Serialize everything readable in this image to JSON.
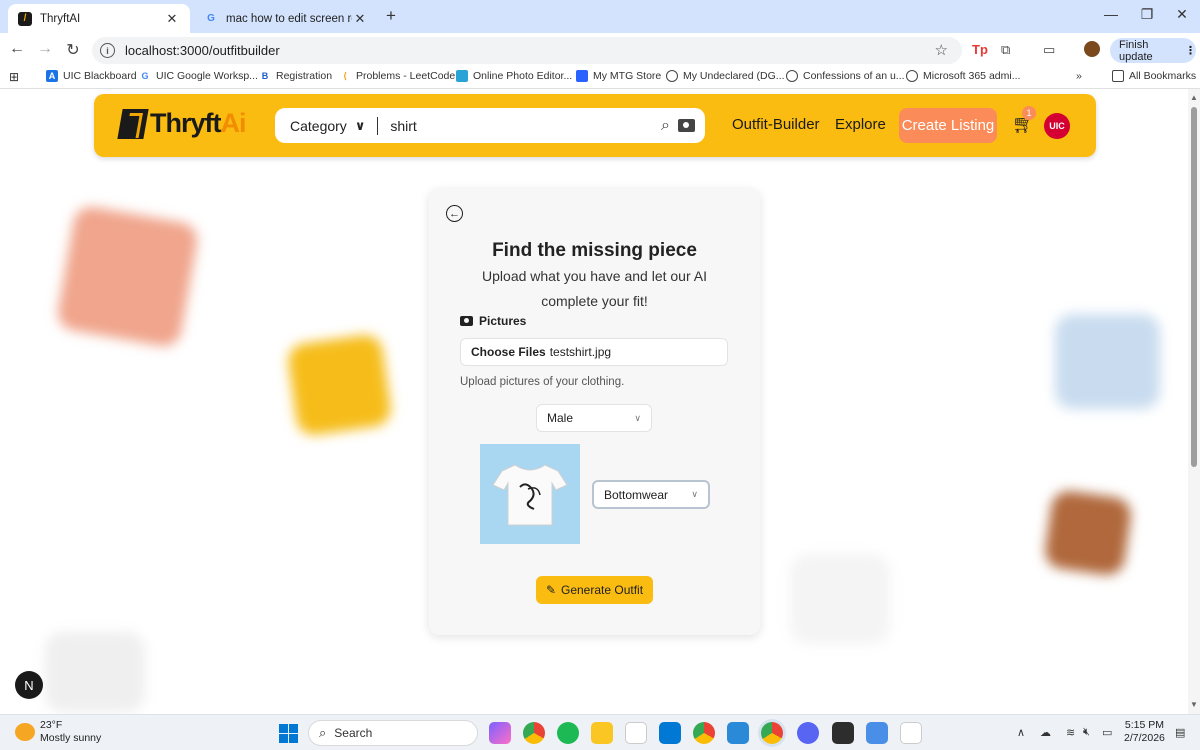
{
  "browser": {
    "tabs": [
      {
        "title": "ThryftAI",
        "active": true
      },
      {
        "title": "mac how to edit screen recordi",
        "active": false
      }
    ],
    "url": "localhost:3000/outfitbuilder",
    "finish_update": "Finish update",
    "bookmarks": [
      "UIC Blackboard",
      "UIC Google Worksp...",
      "Registration",
      "Problems - LeetCode",
      "Online Photo Editor...",
      "My MTG Store",
      "My Undeclared (DG...",
      "Confessions of an u...",
      "Microsoft 365 admi..."
    ],
    "all_bookmarks": "All Bookmarks",
    "more_bookmarks": "»"
  },
  "app": {
    "logo": {
      "main": "Thryft",
      "accent": "Ai"
    },
    "search": {
      "category": "Category",
      "query": "shirt"
    },
    "nav": {
      "outfit_builder": "Outfit-Builder",
      "explore": "Explore",
      "create_listing": "Create Listing"
    },
    "cart_count": "1",
    "avatar": "UIC"
  },
  "builder": {
    "title": "Find the missing piece",
    "subtitle": "Upload what you have and let our AI complete your fit!",
    "pictures_label": "Pictures",
    "choose_files": "Choose Files",
    "file_name": "testshirt.jpg",
    "upload_hint": "Upload pictures of your clothing.",
    "gender": "Male",
    "category": "Bottomwear",
    "generate": "Generate Outfit"
  },
  "next_badge": "N",
  "taskbar": {
    "temp": "23°F",
    "condition": "Mostly sunny",
    "search": "Search",
    "time": "5:15 PM",
    "date": "2/7/2026"
  },
  "colors": {
    "brand_yellow": "#fbbc12",
    "create_orange": "#fb8c5a",
    "uic_red": "#d50032"
  }
}
